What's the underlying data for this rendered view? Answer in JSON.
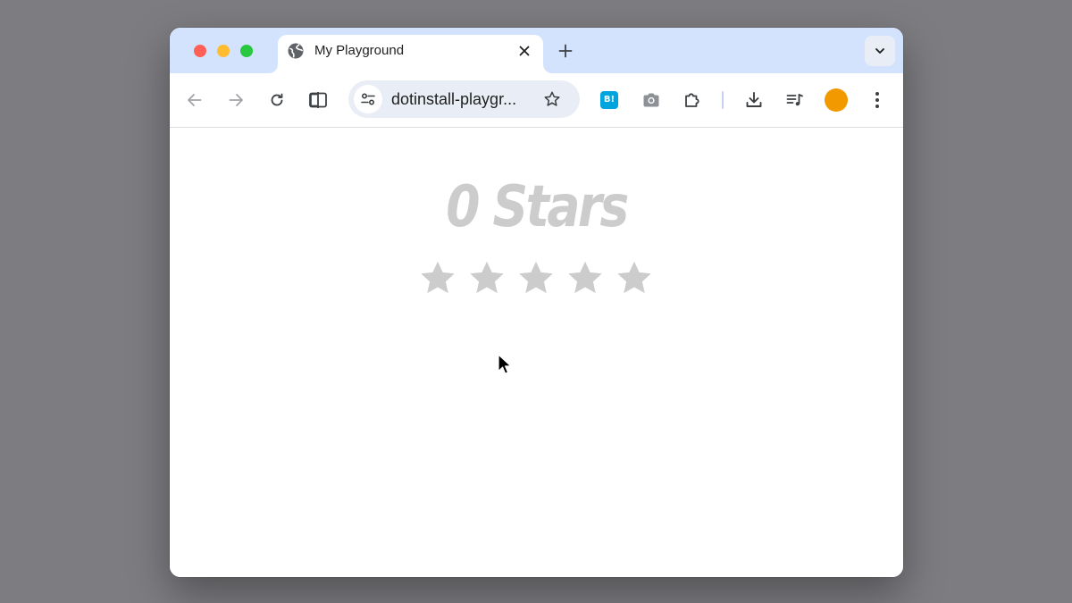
{
  "browser": {
    "tab": {
      "title": "My Playground",
      "favicon": "globe-icon"
    },
    "address_bar": {
      "url": "dotinstall-playgr..."
    },
    "extensions": {
      "hatena_label": "B!"
    },
    "colors": {
      "tabstrip": "#d3e3fd",
      "omnibox": "#e9eef6",
      "avatar": "#f29900",
      "hatena": "#00a4de"
    }
  },
  "page": {
    "rating_label": "0 Stars",
    "rating": {
      "value": 0,
      "max": 5
    },
    "star_color_off": "#cccccc"
  }
}
